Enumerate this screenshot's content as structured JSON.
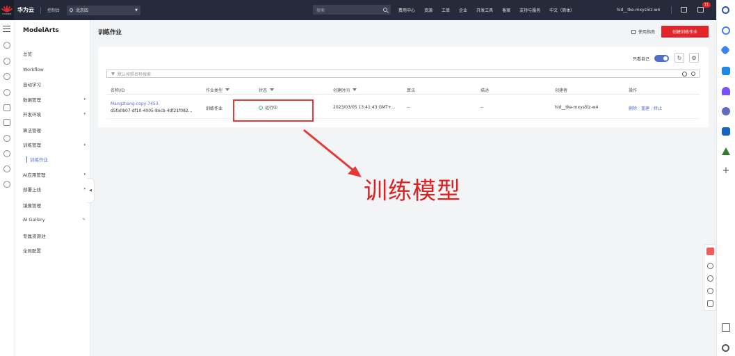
{
  "topbar": {
    "logo_text": "HUAWEI",
    "brand": "华为云",
    "console": "控制台",
    "region": "北京四",
    "search_placeholder": "搜索",
    "nav": [
      "费用中心",
      "资源",
      "工单",
      "企业",
      "开发工具",
      "备案",
      "支持与服务",
      "中文（简体）"
    ],
    "user": "hid__tke-mxys5lz-w4",
    "notification_count": "11"
  },
  "sidebar": {
    "title": "ModelArts",
    "items": [
      {
        "label": "总览"
      },
      {
        "label": "Workflow"
      },
      {
        "label": "自动学习"
      },
      {
        "label": "数据管理",
        "arrow": "▾"
      },
      {
        "label": "开发环境",
        "arrow": "▾"
      },
      {
        "label": "算法管理"
      },
      {
        "label": "训练管理",
        "arrow": "▴"
      },
      {
        "label": "AI应用管理",
        "arrow": "▾"
      },
      {
        "label": "部署上线",
        "arrow": "▾"
      },
      {
        "label": "镜像管理"
      },
      {
        "label": "AI Gallery",
        "arrow": "✎"
      },
      {
        "label": "专属资源池"
      },
      {
        "label": "全局配置"
      }
    ],
    "active_sub": "训练作业"
  },
  "main": {
    "title": "训练作业",
    "guide_label": "使用指南",
    "create_label": "创建训练作业",
    "only_me_label": "只看自己",
    "only_me_on": true,
    "filter_placeholder": "默认按照名称搜索",
    "columns": [
      "名称/ID",
      "作业类型",
      "状态",
      "创建时间",
      "算法",
      "描述",
      "创建者",
      "操作"
    ],
    "row": {
      "name": "Mangzhang-copy-7453",
      "id": "d5fa0b07-df10-4005-8ecb-4df21f082...",
      "type": "训练作业",
      "status": "运行中",
      "created": "2023/03/05 13:41:43 GMT+...",
      "algorithm": "--",
      "description": "--",
      "creator": "hid__tke-mxys5lz-w4",
      "ops": [
        "删除",
        "重建",
        "终止"
      ]
    }
  },
  "annotation": {
    "text": "训练模型",
    "color": "#e02020"
  },
  "colors": {
    "topbar_bg": "#252b3a",
    "accent_blue": "#526ecc",
    "brand_red": "#e0252b"
  }
}
